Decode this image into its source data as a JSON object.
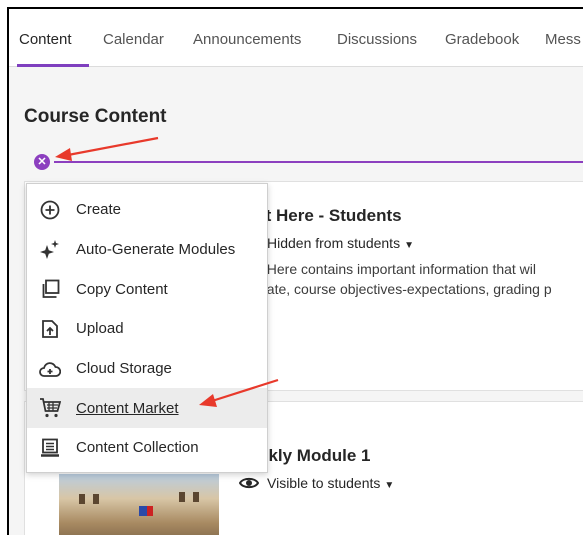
{
  "tabs": [
    {
      "label": "Content",
      "active": true
    },
    {
      "label": "Calendar",
      "active": false
    },
    {
      "label": "Announcements",
      "active": false
    },
    {
      "label": "Discussions",
      "active": false
    },
    {
      "label": "Gradebook",
      "active": false
    },
    {
      "label": "Mess",
      "active": false
    }
  ],
  "page": {
    "title": "Course Content"
  },
  "accent_color": "#8c3fbf",
  "annotation_color": "#e8392b",
  "menu": {
    "items": [
      {
        "label": "Create",
        "icon": "plus-circle-icon"
      },
      {
        "label": "Auto-Generate Modules",
        "icon": "sparkle-icon"
      },
      {
        "label": "Copy Content",
        "icon": "copy-icon"
      },
      {
        "label": "Upload",
        "icon": "upload-icon"
      },
      {
        "label": "Cloud Storage",
        "icon": "cloud-icon"
      },
      {
        "label": "Content Market",
        "icon": "cart-icon",
        "highlighted": true
      },
      {
        "label": "Content Collection",
        "icon": "collection-icon"
      }
    ]
  },
  "cards": [
    {
      "title": "rt Here - Students",
      "visibility": "Hidden from students",
      "desc_line1": ": Here contains important information that wil",
      "desc_line2": "gate, course objectives-expectations, grading p"
    },
    {
      "title": "ekly Module 1",
      "visibility": "Visible to students"
    }
  ]
}
